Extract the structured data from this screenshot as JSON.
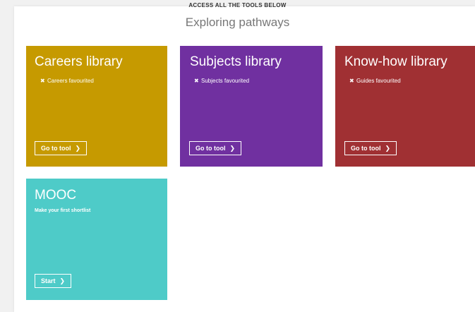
{
  "header": {
    "kicker": "ACCESS ALL THE TOOLS BELOW",
    "title": "Exploring pathways"
  },
  "cards": [
    {
      "title": "Careers library",
      "line": "Careers favourited",
      "line_icon": "x-icon",
      "button": "Go to tool",
      "button_icon": "chevron-right-icon",
      "color": "#c69a00"
    },
    {
      "title": "Subjects library",
      "line": "Subjects favourited",
      "line_icon": "x-icon",
      "button": "Go to tool",
      "button_icon": "chevron-right-icon",
      "color": "#7030a0"
    },
    {
      "title": "Know-how library",
      "line": "Guides favourited",
      "line_icon": "x-icon",
      "button": "Go to tool",
      "button_icon": "chevron-right-icon",
      "color": "#a03033"
    },
    {
      "title": "MOOC",
      "subtitle": "Make your first shortlist",
      "button": "Start",
      "button_icon": "chevron-right-icon",
      "color": "#4ecbc8"
    }
  ],
  "background_color": "#f1f1f1"
}
